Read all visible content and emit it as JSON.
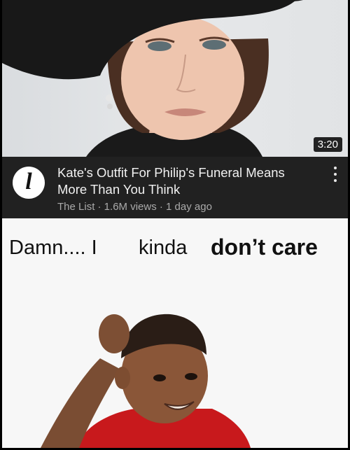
{
  "video": {
    "duration": "3:20",
    "channel_logo_letter": "l",
    "title": "Kate's Outfit For Philip's Funeral Means More Than You Think",
    "subline": "The List · 1.6M views · 1 day ago",
    "menu_icon": "more-vert-icon"
  },
  "meme": {
    "caption_part1": "Damn.... I",
    "caption_part2": "kinda",
    "caption_part3": "don’t care"
  },
  "colors": {
    "card_background": "#212121",
    "title_text": "#f1f1f1",
    "subline_text": "#aaaaaa",
    "meme_background": "#f7f7f7"
  }
}
